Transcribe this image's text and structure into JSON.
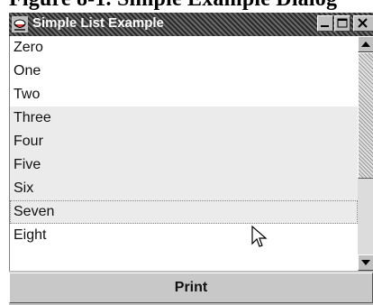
{
  "heading": {
    "text": "Figure 8-1. Simple Example Dialog"
  },
  "window": {
    "title": "Simple List Example",
    "icons": {
      "app": "java-cup-icon",
      "minimize": "minimize-icon",
      "maximize": "maximize-icon",
      "close": "close-icon"
    }
  },
  "list": {
    "items": [
      {
        "label": "Zero",
        "shaded": false
      },
      {
        "label": "One",
        "shaded": false
      },
      {
        "label": "Two",
        "shaded": false
      },
      {
        "label": "Three",
        "shaded": true
      },
      {
        "label": "Four",
        "shaded": true
      },
      {
        "label": "Five",
        "shaded": true
      },
      {
        "label": "Six",
        "shaded": true
      },
      {
        "label": "Seven",
        "shaded": true,
        "focused": true
      },
      {
        "label": "Eight",
        "shaded": false
      }
    ]
  },
  "buttons": {
    "print_label": "Print"
  },
  "icons": {
    "scroll_up": "arrow-up-icon",
    "scroll_down": "arrow-down-icon",
    "cursor": "mouse-pointer-icon"
  }
}
